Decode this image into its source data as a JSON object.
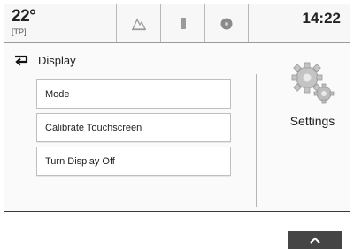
{
  "status": {
    "temperature": "22°",
    "temperature_sub": "[TP]",
    "time": "14:22"
  },
  "tabs": [
    {
      "icon": "navigation-icon"
    },
    {
      "icon": "phone-icon"
    },
    {
      "icon": "onstar-icon"
    }
  ],
  "screen": {
    "title": "Display",
    "back_icon": "back-arrow-icon"
  },
  "menu": {
    "items": [
      {
        "label": "Mode"
      },
      {
        "label": "Calibrate Touchscreen"
      },
      {
        "label": "Turn Display Off"
      }
    ]
  },
  "settings": {
    "icon": "gears-icon",
    "label": "Settings"
  },
  "scroll": {
    "icon": "chevron-up-icon"
  }
}
